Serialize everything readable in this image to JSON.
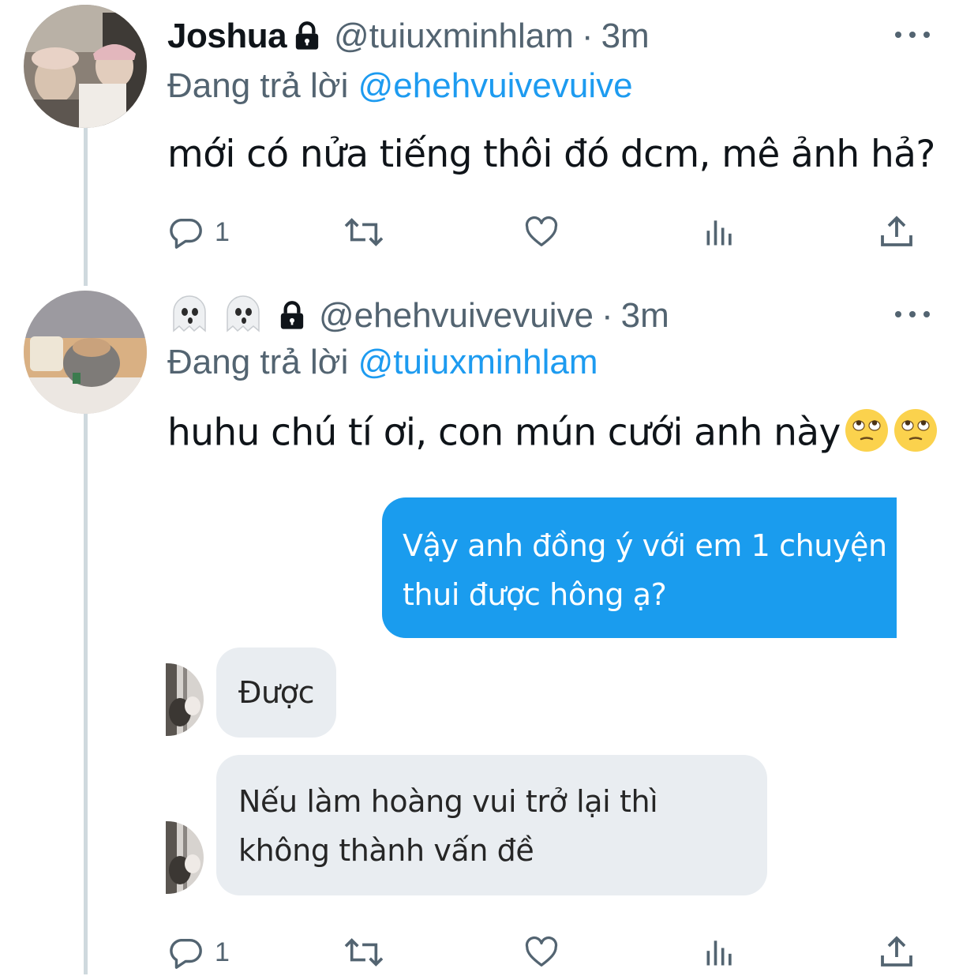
{
  "tweet1": {
    "display_name": "Joshua",
    "handle": "@tuiuxminhlam",
    "separator": "·",
    "time": "3m",
    "reply_prefix": "Đang trả lời",
    "reply_mention": "@ehehvuivevuive",
    "text": "mới có nửa tiếng thôi đó dcm, mê ảnh hả?",
    "reply_count": "1",
    "icons": [
      "lock-icon",
      "more-icon",
      "reply-icon",
      "retweet-icon",
      "like-icon",
      "views-icon",
      "share-icon"
    ]
  },
  "tweet2": {
    "display_name_emojis": [
      "ghost-emoji",
      "ghost-emoji"
    ],
    "handle": "@ehehvuivevuive",
    "separator": "·",
    "time": "3m",
    "reply_prefix": "Đang trả lời",
    "reply_mention": "@tuiuxminhlam",
    "text": "huhu chú tí ơi, con mún cưới anh này",
    "text_emojis": [
      "face-with-rolling-eyes-emoji",
      "face-with-rolling-eyes-emoji"
    ],
    "reply_count": "1",
    "chat_image": {
      "outgoing_message_lines": [
        "Vậy anh đồng ý với em 1 chuyện",
        "thui được hông ạ?"
      ],
      "incoming_messages": [
        {
          "lines": [
            "Được"
          ]
        },
        {
          "lines": [
            "Nếu làm hoàng vui trở lại thì",
            "không thành vấn đề"
          ]
        }
      ]
    }
  },
  "colors": {
    "accent": "#1d9bf0",
    "secondary_text": "#536471",
    "thread_line": "#cfd9de",
    "outgoing_bubble": "#1a9cee",
    "incoming_bubble": "#e9edf1"
  }
}
